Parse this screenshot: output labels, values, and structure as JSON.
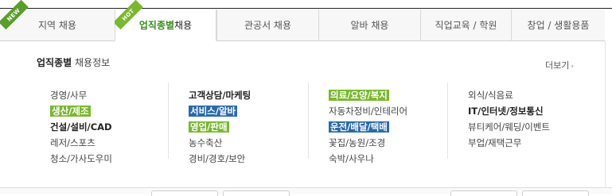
{
  "tabs": [
    {
      "label": "지역 채용",
      "ribbon": "NEW"
    },
    {
      "label_accent": "업직종별",
      "label_rest": " 채용",
      "ribbon": "HOT"
    },
    {
      "label": "관공서 채용"
    },
    {
      "label": "알바 채용"
    },
    {
      "label": "직업교육 / 학원"
    },
    {
      "label": "창업 / 생활용품"
    }
  ],
  "panel": {
    "title_bold": "업직종별",
    "title_rest": " 채용정보",
    "more_label": "더보기",
    "more_icon": "chevron-right-icon"
  },
  "columns": [
    {
      "items": [
        {
          "label": "경영/사무",
          "style": "plain"
        },
        {
          "label": "생산/제조",
          "style": "green"
        },
        {
          "label": "건설/설비/CAD",
          "style": "bold"
        },
        {
          "label": "레저/스포츠",
          "style": "plain"
        },
        {
          "label": "청소/가사도우미",
          "style": "plain"
        }
      ]
    },
    {
      "items": [
        {
          "label": "고객상담/마케팅",
          "style": "bold"
        },
        {
          "label": "서비스/알바",
          "style": "blue"
        },
        {
          "label": "영업/판매",
          "style": "green"
        },
        {
          "label": "농수축산",
          "style": "plain"
        },
        {
          "label": "경비/경호/보안",
          "style": "plain"
        }
      ]
    },
    {
      "items": [
        {
          "label": "의료/요양/복지",
          "style": "green"
        },
        {
          "label": "자동차정비/인테리어",
          "style": "plain"
        },
        {
          "label": "운전/배달/택배",
          "style": "blue"
        },
        {
          "label": "꽃집/농원/조경",
          "style": "plain"
        },
        {
          "label": "숙박/사우나",
          "style": "plain"
        }
      ]
    },
    {
      "items": [
        {
          "label": "외식/식음료",
          "style": "plain"
        },
        {
          "label": "IT/인터넷/정보통신",
          "style": "bold"
        },
        {
          "label": "뷰티케어/웨딩/이벤트",
          "style": "plain"
        },
        {
          "label": "부업/재택근무",
          "style": "plain"
        }
      ]
    }
  ],
  "colors": {
    "accent_green": "#7ab82f",
    "accent_blue": "#2a6aab",
    "ribbon_green": "#5a9e2a"
  }
}
